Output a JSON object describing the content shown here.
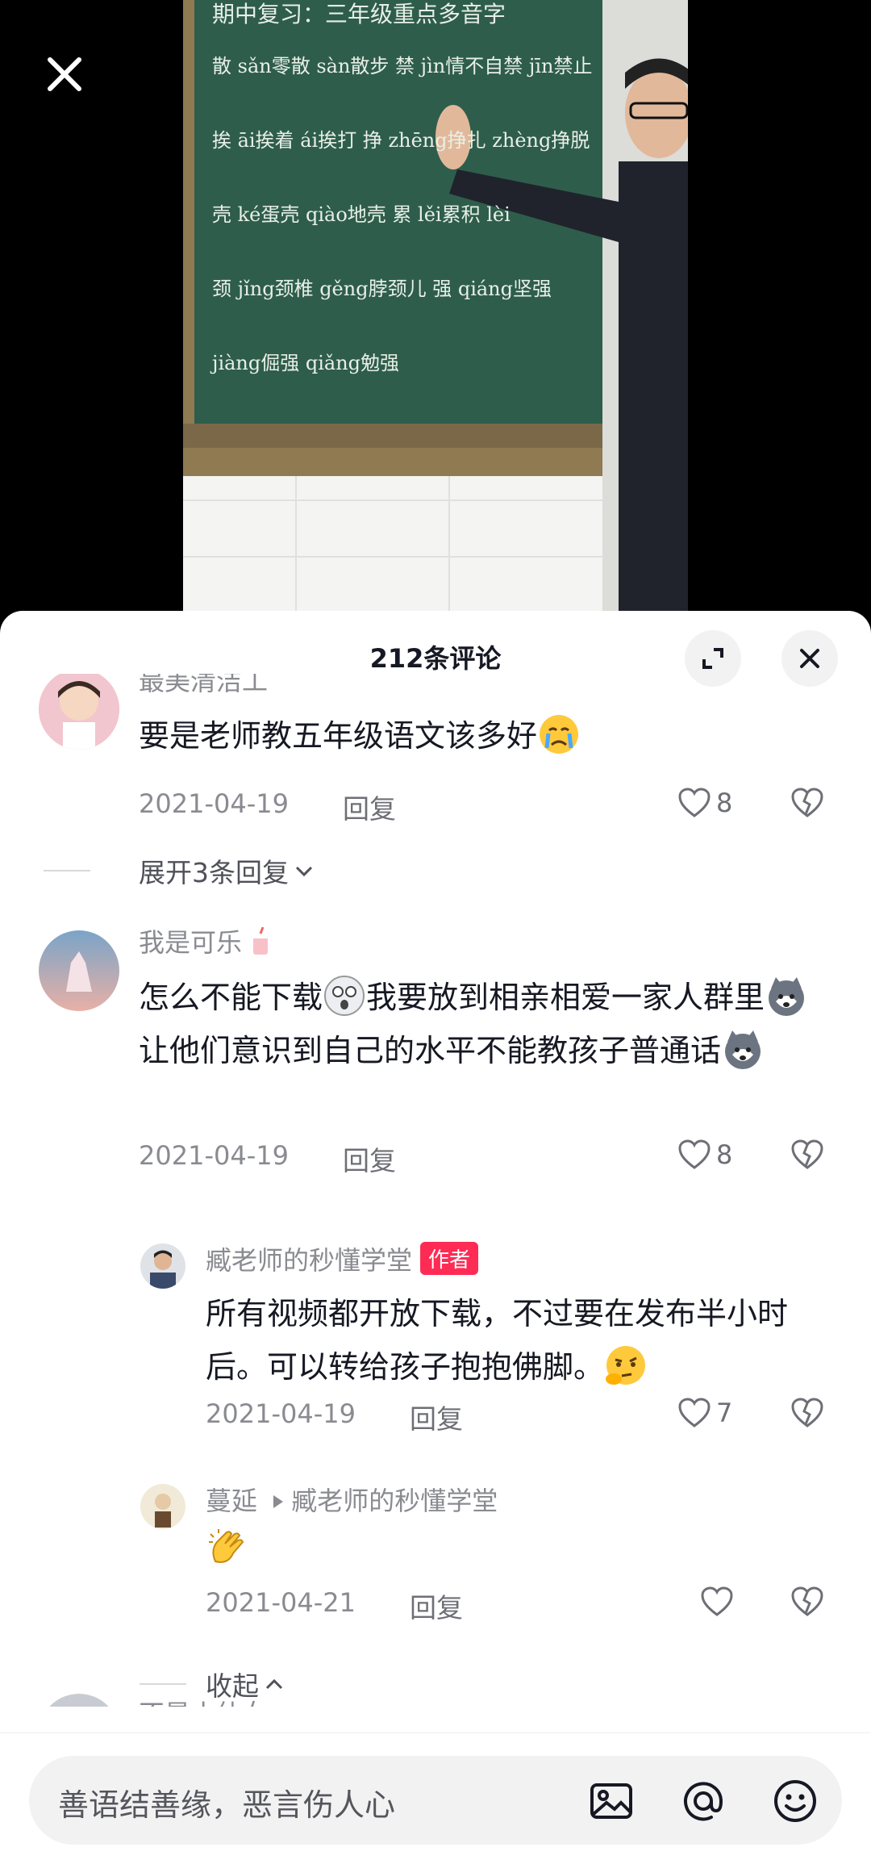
{
  "video": {
    "board_lines": [
      "期中复习：三年级重点多音字",
      "散 sǎn零散 sàn散步   禁 jìn情不自禁 jīn禁止",
      "挨 āi挨着 ái挨打   挣 zhēng挣扎 zhèng挣脱",
      "壳 ké蛋壳 qiào地壳   累 lěi累积 lèi",
      "颈 jǐng颈椎 gěng脖颈儿   强 qiáng坚强 jiàng倔强 qiǎng勉强"
    ]
  },
  "header": {
    "title": "212条评论"
  },
  "comments": [
    {
      "username": "最美清洁工",
      "text": "要是老师教五年级语文该多好",
      "date": "2021-04-19",
      "reply_label": "回复",
      "likes": "8",
      "expand_label": "展开3条回复"
    },
    {
      "username": "我是可乐",
      "text_part1": "怎么不能下载",
      "text_part2": "我要放到相亲相爱一家人群里",
      "text_part3": "让他们意识到自己的水平不能教孩子普通话",
      "date": "2021-04-19",
      "reply_label": "回复",
      "likes": "8"
    }
  ],
  "replies": [
    {
      "username": "臧老师的秒懂学堂",
      "badge": "作者",
      "text": "所有视频都开放下载，不过要在发布半小时后。可以转给孩子抱抱佛脚。",
      "date": "2021-04-19",
      "reply_label": "回复",
      "likes": "7"
    },
    {
      "username": "蔓延",
      "reply_to": "臧老师的秒懂学堂",
      "date": "2021-04-21",
      "reply_label": "回复"
    }
  ],
  "collapse_label": "收起",
  "next_username": "不是小仙女",
  "input": {
    "placeholder": "善语结善缘，恶言伤人心"
  },
  "icons": {
    "close": "close-icon",
    "expand": "expand-icon",
    "like": "heart-icon",
    "dislike": "broken-heart-icon",
    "image": "image-icon",
    "mention": "at-icon",
    "emoji": "emoji-icon"
  },
  "colors": {
    "author_badge": "#fe2c55",
    "board": "#2e5d4c",
    "text": "#161823",
    "muted": "#8a8b91"
  }
}
